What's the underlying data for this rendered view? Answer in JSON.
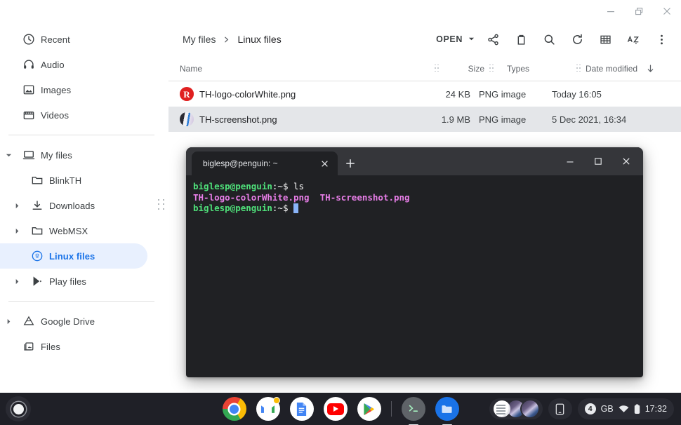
{
  "window": {
    "controls": [
      {
        "name": "minimize-button",
        "glyph": "minimize"
      },
      {
        "name": "restore-button",
        "glyph": "restore"
      },
      {
        "name": "close-button",
        "glyph": "close"
      }
    ]
  },
  "sidebar": {
    "quick_items": [
      {
        "label": "Recent",
        "icon": "clock-icon"
      },
      {
        "label": "Audio",
        "icon": "headphones-icon"
      },
      {
        "label": "Images",
        "icon": "image-icon"
      },
      {
        "label": "Videos",
        "icon": "video-icon"
      }
    ],
    "tree": [
      {
        "label": "My files",
        "icon": "computer-icon",
        "expanded": true,
        "level": 0
      },
      {
        "label": "BlinkTH",
        "icon": "folder-icon",
        "level": 1,
        "twisty": false
      },
      {
        "label": "Downloads",
        "icon": "download-icon",
        "level": 1,
        "twisty": true
      },
      {
        "label": "WebMSX",
        "icon": "folder-icon",
        "level": 1,
        "twisty": true
      },
      {
        "label": "Linux files",
        "icon": "linux-penguin-icon",
        "level": 1,
        "twisty": false,
        "selected": true
      },
      {
        "label": "Play files",
        "icon": "play-store-icon",
        "level": 1,
        "twisty": true
      }
    ],
    "services": [
      {
        "label": "Google Drive",
        "icon": "drive-icon",
        "twisty": true
      },
      {
        "label": "Files",
        "icon": "files-icon",
        "twisty": false
      }
    ]
  },
  "toolbar": {
    "breadcrumb": [
      "My files",
      "Linux files"
    ],
    "open_label": "OPEN",
    "actions": [
      {
        "name": "share-icon",
        "title": "Share"
      },
      {
        "name": "delete-icon",
        "title": "Delete"
      },
      {
        "name": "search-icon",
        "title": "Search"
      },
      {
        "name": "refresh-icon",
        "title": "Refresh"
      },
      {
        "name": "grid-view-icon",
        "title": "Switch to grid view"
      },
      {
        "name": "sort-az-icon",
        "title": "Sort"
      },
      {
        "name": "more-options-icon",
        "title": "More options"
      }
    ]
  },
  "file_list": {
    "columns": [
      "Name",
      "Size",
      "Types",
      "Date modified"
    ],
    "sort_direction": "descending",
    "rows": [
      {
        "name": "TH-logo-colorWhite.png",
        "size": "24 KB",
        "type": "PNG image",
        "date": "Today 16:05",
        "icon": "th-logo-thumbnail",
        "selected": false
      },
      {
        "name": "TH-screenshot.png",
        "size": "1.9 MB",
        "type": "PNG image",
        "date": "5 Dec 2021, 16:34",
        "icon": "screenshot-thumbnail",
        "selected": true
      }
    ]
  },
  "terminal": {
    "tab_title": "biglesp@penguin: ~",
    "new_tab_label": "+",
    "close_tab_label": "×",
    "lines": [
      {
        "prompt_user": "biglesp@penguin",
        "prompt_path": ":~$ ",
        "command": "ls"
      },
      {
        "files": [
          "TH-logo-colorWhite.png",
          "TH-screenshot.png"
        ]
      },
      {
        "prompt_user": "biglesp@penguin",
        "prompt_path": ":~$ ",
        "command": ""
      }
    ],
    "colors": {
      "background": "#202124",
      "tabbar": "#35363a",
      "prompt_user": "#4fe07a",
      "prompt_path": "#ffffff",
      "filename": "#e87ee8",
      "cursor": "#8ab4f8"
    }
  },
  "shelf": {
    "launcher_name": "launcher-button",
    "apps": [
      {
        "name": "chrome-icon",
        "label": "Chrome",
        "running": false
      },
      {
        "name": "gmail-icon",
        "label": "Gmail",
        "running": false
      },
      {
        "name": "google-docs-icon",
        "label": "Docs",
        "running": false
      },
      {
        "name": "youtube-icon",
        "label": "YouTube",
        "running": false
      },
      {
        "name": "play-store-icon",
        "label": "Play Store",
        "running": false
      },
      {
        "name": "terminal-icon",
        "label": "Terminal",
        "running": true
      },
      {
        "name": "files-icon",
        "label": "Files",
        "running": true
      }
    ],
    "tray": {
      "notification_count": "4",
      "keyboard_layout": "GB",
      "time": "17:32",
      "icons": [
        "notification-thumbnails",
        "phone-hub-icon",
        "wifi-icon",
        "battery-icon"
      ]
    }
  },
  "colors": {
    "accent": "#1a73e8",
    "selected_nav_bg": "#e8f0fe",
    "selected_row_bg": "#e4e6e9",
    "shelf_bg": "#1f2027"
  }
}
